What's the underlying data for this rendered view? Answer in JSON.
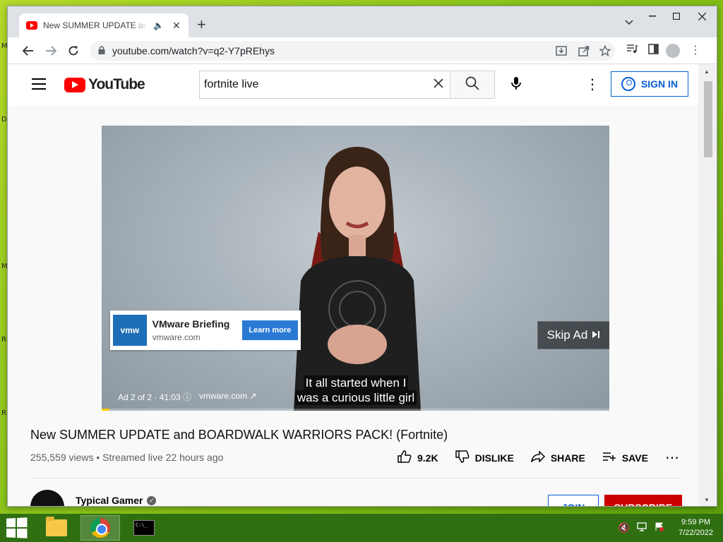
{
  "desktop": {
    "edge_letters": [
      "M",
      "D",
      "M",
      "R",
      "R"
    ]
  },
  "browser": {
    "tab": {
      "title": "New SUMMER UPDATE and BOARDWALK WARRIORS PACK! (Fortnite) - YouTube"
    },
    "new_tab_symbol": "+",
    "url": "youtube.com/watch?v=q2-Y7pREhys"
  },
  "youtube": {
    "logo_text": "YouTube",
    "search": {
      "value": "fortnite live"
    },
    "sign_in_label": "SIGN IN",
    "player": {
      "ad_overlay": {
        "logo_text": "vmw",
        "title": "VMware Briefing",
        "domain": "vmware.com",
        "cta": "Learn more"
      },
      "skip_label": "Skip Ad",
      "ad_info": "Ad 2 of 2 · 41:03",
      "ad_domain": "vmware.com",
      "caption_lines": [
        "It all started when I",
        "was a curious little girl"
      ],
      "ad_progress_fraction": 0.015,
      "progress_color": "#ffcc00"
    },
    "video": {
      "title": "New SUMMER UPDATE and BOARDWALK WARRIORS PACK! (Fortnite)",
      "meta": "255,559 views • Streamed live 22 hours ago",
      "actions": {
        "like_count": "9.2K",
        "dislike": "DISLIKE",
        "share": "SHARE",
        "save": "SAVE"
      }
    },
    "channel": {
      "name": "Typical Gamer",
      "join": "JOIN",
      "subscribe": "SUBSCRIBE"
    }
  },
  "taskbar": {
    "time": "9:59 PM",
    "date": "7/22/2022"
  },
  "colors": {
    "youtube_red": "#ff0000",
    "link_blue": "#065fd4",
    "subscribe_red": "#cc0000",
    "taskbar": "#2f6f12"
  }
}
